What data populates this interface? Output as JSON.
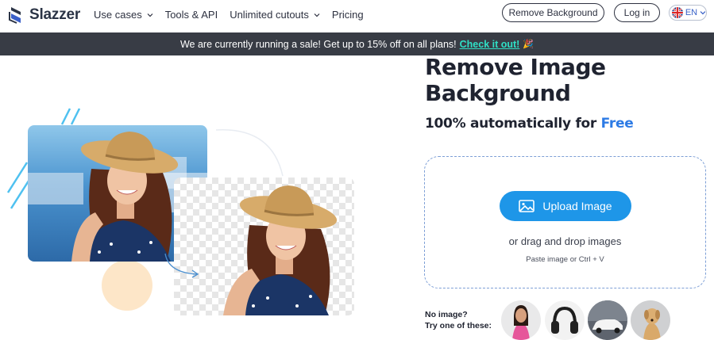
{
  "nav": {
    "brand": "Slazzer",
    "links": [
      {
        "label": "Use cases",
        "dropdown": true
      },
      {
        "label": "Tools & API",
        "dropdown": false
      },
      {
        "label": "Unlimited cutouts",
        "dropdown": true
      },
      {
        "label": "Pricing",
        "dropdown": false
      }
    ],
    "remove_bg_button": "Remove Background",
    "login_button": "Log in",
    "language": "EN"
  },
  "banner": {
    "text": "We are currently running a sale! Get up to 15% off on all plans!",
    "link": "Check it out!",
    "emoji": "🎉"
  },
  "hero": {
    "title_line1": "Remove Image",
    "title_line2": "Background",
    "subtitle_prefix": "100% automatically for",
    "subtitle_free": "Free"
  },
  "upload": {
    "button_label": "Upload Image",
    "drag_text": "or drag and drop images",
    "paste_text": "Paste image or Ctrl + V"
  },
  "samples": {
    "prompt_line1": "No image?",
    "prompt_line2": "Try one of these:",
    "items": [
      "woman-sample",
      "headphones-sample",
      "car-sample",
      "dog-sample"
    ]
  },
  "colors": {
    "accent": "#1e96e8",
    "free_text": "#2d7be5",
    "banner_bg": "#383c45",
    "banner_link": "#2fe0c6"
  }
}
